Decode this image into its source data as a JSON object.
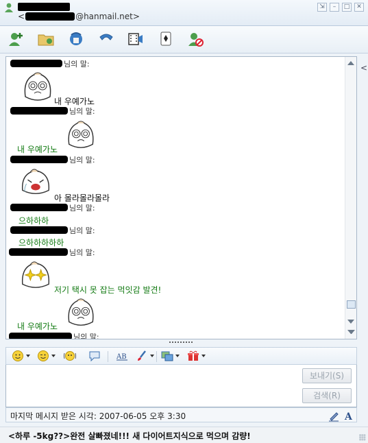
{
  "window": {
    "email_suffix": "@hanmail.net>",
    "email_prefix": "<",
    "controls": [
      "⇲",
      "–",
      "□",
      "✕"
    ]
  },
  "toolbar": {
    "icons": [
      "add-friend-icon",
      "file-transfer-icon",
      "file-share-icon",
      "call-icon",
      "video-call-icon",
      "game-icon",
      "block-icon"
    ]
  },
  "chat": {
    "messages": [
      {
        "header": "님의 말:",
        "text": "내 우예가노",
        "color": "#111111",
        "emoticon": "dizzy-face"
      },
      {
        "header": "님의 말:",
        "text": "내 우예가노",
        "color": "#127a12",
        "emoticon": "dizzy-face"
      },
      {
        "header": "님의 말:",
        "text": "아 몰라몰라몰라",
        "color": "#111111",
        "emoticon": "crying-face"
      },
      {
        "header": "님의 말:",
        "text": "으하하하",
        "color": "#127a12"
      },
      {
        "header": "님의 말:",
        "text": "으하하하하하",
        "color": "#127a12"
      },
      {
        "header": "님의 말:",
        "text": "저기 택시 못 잡는 먹잇감 발견!",
        "color": "#127a12",
        "emoticon": "sparkle-eyes-face"
      },
      {
        "header": "님의 말:",
        "text": "내 우예가노",
        "color": "#127a12",
        "emoticon": "dizzy-face"
      }
    ]
  },
  "input": {
    "send_label": "보내기(S)",
    "search_label": "검색(R)"
  },
  "status": {
    "text": "마지막 메시지 받은 시각: 2007-06-05 오후 3:30"
  },
  "bottom": {
    "text": "<하루 -5kg??>완전 살빠졌네!!! 새 다이어트지식으로 먹으며 감량!"
  },
  "side_tab": "<",
  "colors": {
    "accent": "#3a6fb0",
    "green_text": "#127a12"
  }
}
